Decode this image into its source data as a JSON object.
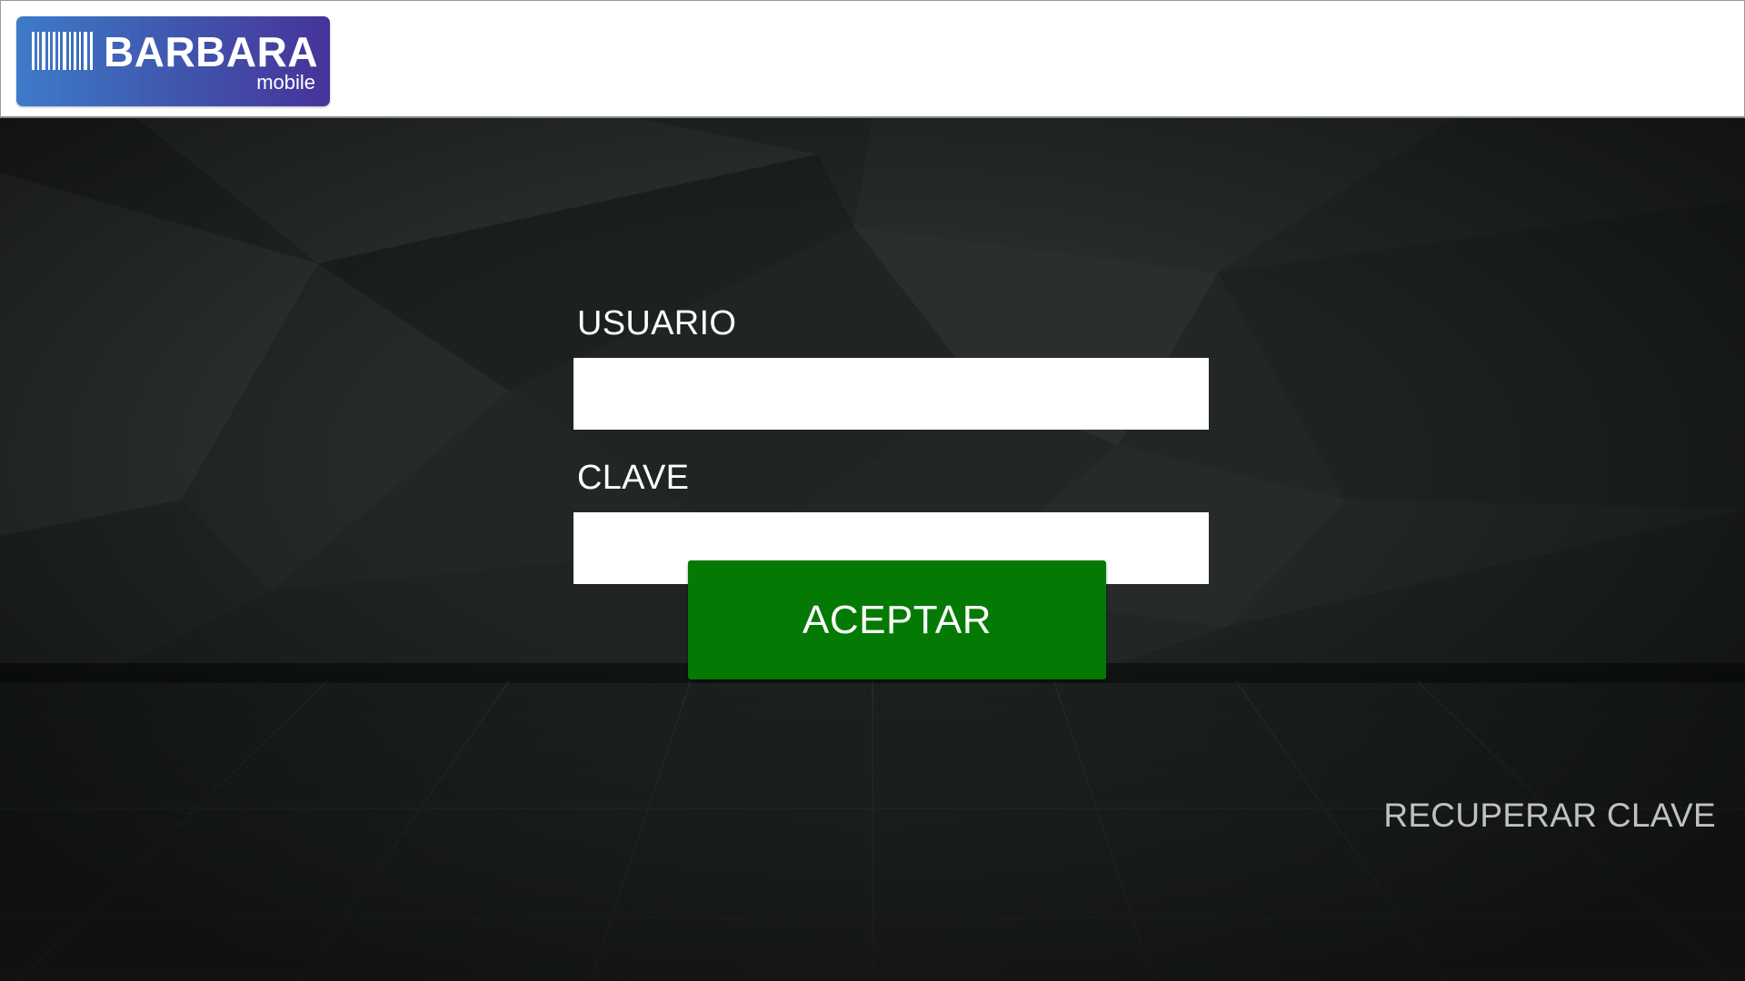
{
  "header": {
    "logo": {
      "title": "BARBARA",
      "subtitle": "mobile",
      "icon": "barcode-icon"
    }
  },
  "login_form": {
    "user_label": "USUARIO",
    "user_value": "",
    "password_label": "CLAVE",
    "password_value": "",
    "accept_label": "ACEPTAR",
    "recover_label": "RECUPERAR CLAVE"
  },
  "colors": {
    "accept_button": "#047a05",
    "logo_gradient_start": "#3e7bc9",
    "logo_gradient_end": "#46339a",
    "background": "#1b201e"
  }
}
